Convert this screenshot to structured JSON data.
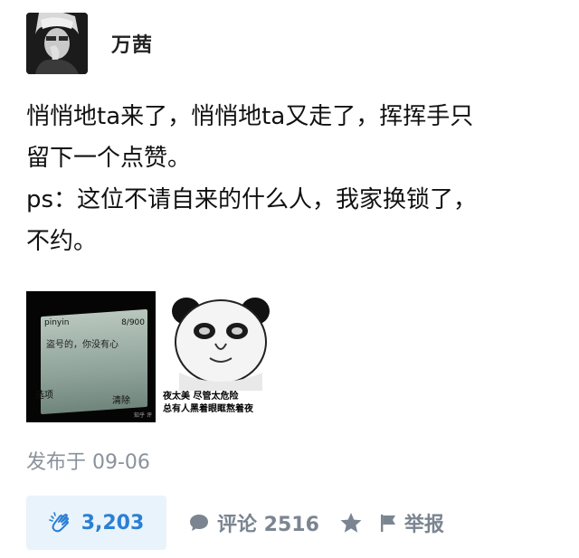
{
  "author": {
    "name": "万茜"
  },
  "post": {
    "lines": [
      "悄悄地ta来了，悄悄地ta又走了，挥挥手只",
      "留下一个点赞。",
      "ps：这位不请自来的什么人，我家换锁了，",
      "不约。"
    ],
    "image_1": {
      "ime": "pinyin",
      "counter": "8/900",
      "message": "盗号的，你没有心",
      "left_softkey": "选项",
      "right_softkey": "清除",
      "corner_mark": "知乎 评"
    },
    "image_2": {
      "caption_line1": "夜太美 尽管太危险",
      "caption_line2": "总有人黑着眼眶熬着夜"
    }
  },
  "meta": {
    "publish_text": "发布于 09-06"
  },
  "actions": {
    "clap_count": "3,203",
    "comment_label": "评论 2516",
    "report_label": "举报"
  },
  "colors": {
    "accent": "#2b7fd4",
    "accent_bg": "#e9f3fb",
    "muted": "#7b8591"
  },
  "icons": [
    "clap-icon",
    "comment-icon",
    "star-icon",
    "flag-icon"
  ]
}
